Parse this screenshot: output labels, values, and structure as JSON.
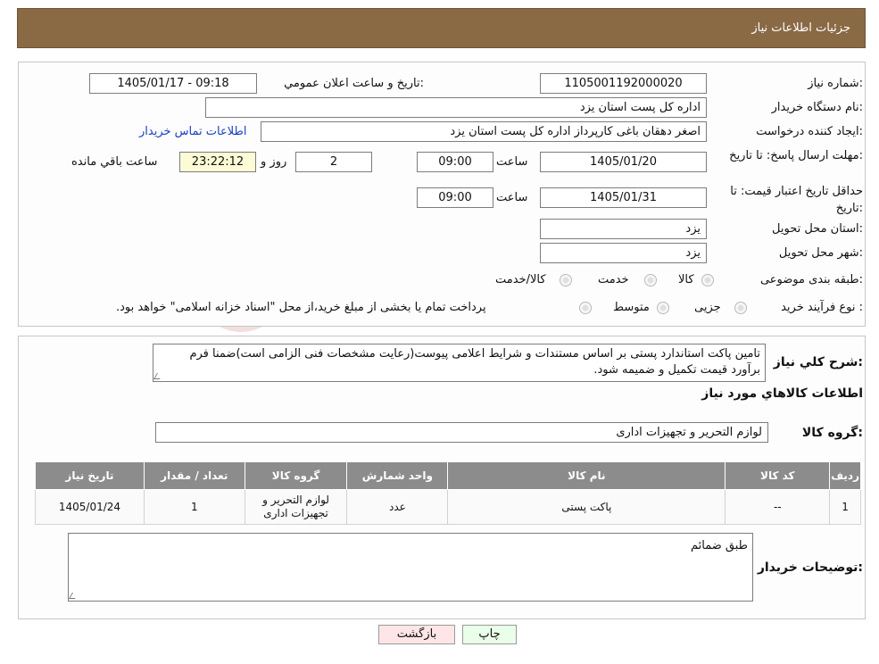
{
  "header": {
    "title": "جزئيات اطلاعات نياز"
  },
  "watermark": {
    "text": "AriaTender.neT"
  },
  "info": {
    "need_number_label": "شماره نياز:",
    "need_number": "1105001192000020",
    "announce_label": "تاريخ و ساعت اعلان عمومي:",
    "announce_value": "1405/01/17 - 09:18",
    "buyer_label": "نام دستگاه خريدار:",
    "buyer_value": "اداره کل پست استان یزد",
    "creator_label": "ايجاد کننده درخواست:",
    "creator_value": "اصغر دهقان باغی کارپرداز اداره کل پست استان یزد",
    "contact_link": "اطلاعات تماس خريدار",
    "deadline_label": "مهلت ارسال پاسخ: تا تاريخ:",
    "deadline_date": "1405/01/20",
    "hour_label": "ساعت",
    "deadline_time": "09:00",
    "days_value": "2",
    "days_label": "روز و",
    "remaining_time": "23:22:12",
    "remaining_label": "ساعت باقي مانده",
    "validity_label": "حداقل تاريخ اعتبار قيمت: تا تاريخ:",
    "validity_date": "1405/01/31",
    "validity_time": "09:00",
    "province_label": "استان محل تحويل:",
    "province_value": "یزد",
    "city_label": "شهر محل تحويل:",
    "city_value": "یزد",
    "category_label": "طبقه بندی موضوعی:",
    "category_options": [
      "کالا",
      "خدمت",
      "کالا/خدمت"
    ],
    "process_label": "نوع فرآيند خريد :",
    "process_options": [
      "جزیی",
      "متوسط"
    ],
    "process_note": "پرداخت تمام يا بخشی از مبلغ خريد،از محل \"اسناد خزانه اسلامی\" خواهد بود."
  },
  "summary": {
    "label": "شرح کلي نياز:",
    "text": "تامین پاکت استاندارد پستی بر اساس مستندات و شرایط اعلامی  پیوست(رعایت مشخصات فنی الزامی است)ضمنا فرم برآورد قیمت تکمیل و ضمیمه شود."
  },
  "goods": {
    "section_title": "اطلاعات کالاهاي مورد نياز",
    "group_label": "گروه کالا:",
    "group_value": "لوازم التحرير و تجهيزات اداری",
    "columns": [
      "رديف",
      "کد کالا",
      "نام کالا",
      "واحد شمارش",
      "گروه کالا",
      "تعداد / مقدار",
      "تاريخ نياز"
    ],
    "rows": [
      [
        "1",
        "--",
        "پاکت پستی",
        "عدد",
        "لوازم التحرير و تجهيزات اداری",
        "1",
        "1405/01/24"
      ]
    ]
  },
  "buyer_notes": {
    "label": "توضيحات خريدار:",
    "text": "طبق ضمائم"
  },
  "buttons": {
    "print": "چاپ",
    "back": "بازگشت"
  },
  "colors": {
    "header_bg": "#8a6a45",
    "table_header_bg": "#8c8c8c",
    "print_btn_bg": "#eaffea",
    "back_btn_bg": "#ffe6e6"
  }
}
